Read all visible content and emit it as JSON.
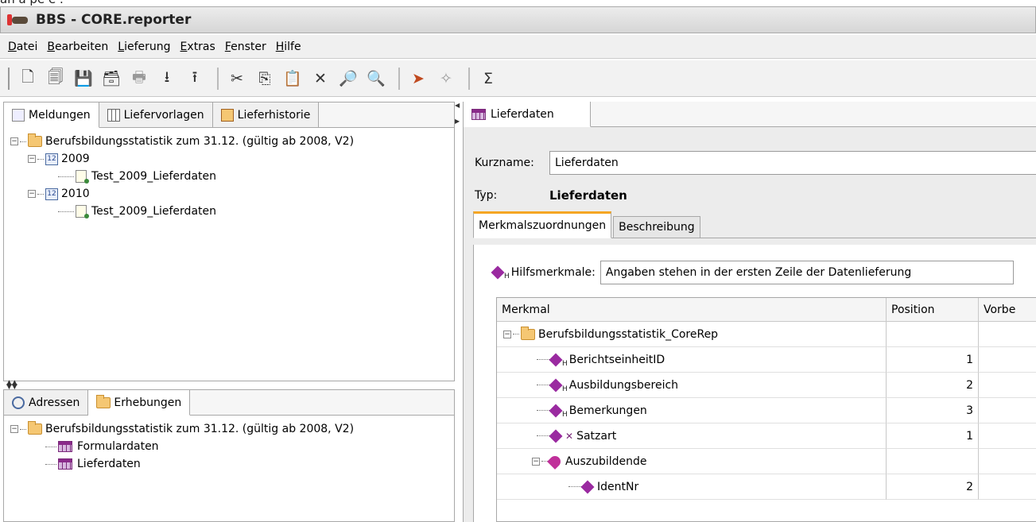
{
  "window": {
    "title": "BBS - CORE.reporter"
  },
  "menu": [
    {
      "label": "Datei",
      "u": "D",
      "rest": "atei"
    },
    {
      "label": "Bearbeiten",
      "u": "B",
      "rest": "earbeiten"
    },
    {
      "label": "Lieferung",
      "u": "L",
      "rest": "ieferung"
    },
    {
      "label": "Extras",
      "u": "E",
      "rest": "xtras"
    },
    {
      "label": "Fenster",
      "u": "F",
      "rest": "enster"
    },
    {
      "label": "Hilfe",
      "u": "H",
      "rest": "ilfe"
    }
  ],
  "toolbar": {
    "sigma": "Σ"
  },
  "left_top": {
    "tabs": [
      "Meldungen",
      "Liefervorlagen",
      "Lieferhistorie"
    ],
    "tree": {
      "root": "Berufsbildungsstatistik zum 31.12. (gültig ab 2008, V2)",
      "y1": "2009",
      "y1_child": "Test_2009_Lieferdaten",
      "y2": "2010",
      "y2_child": "Test_2009_Lieferdaten"
    }
  },
  "left_bottom": {
    "tabs": [
      "Adressen",
      "Erhebungen"
    ],
    "tree": {
      "root": "Berufsbildungsstatistik zum 31.12. (gültig ab 2008, V2)",
      "child1": "Formulardaten",
      "child2": "Lieferdaten"
    }
  },
  "right": {
    "tab": "Lieferdaten",
    "kurzname_label": "Kurzname:",
    "kurzname_value": "Lieferdaten",
    "typ_label": "Typ:",
    "typ_value": "Lieferdaten",
    "subtabs": [
      "Merkmalszuordnungen",
      "Beschreibung"
    ],
    "hilfs_label": "Hilfsmerkmale:",
    "hilfs_value": "Angaben stehen in der ersten Zeile der Datenlieferung",
    "grid": {
      "headers": [
        "Merkmal",
        "Position",
        "Vorbe"
      ],
      "rows": [
        {
          "name": "Berufsbildungsstatistik_CoreRep",
          "pos": ""
        },
        {
          "name": "BerichtseinheitID",
          "pos": "1"
        },
        {
          "name": "Ausbildungsbereich",
          "pos": "2"
        },
        {
          "name": "Bemerkungen",
          "pos": "3"
        },
        {
          "name": "Satzart",
          "pos": "1"
        },
        {
          "name": "Auszubildende",
          "pos": ""
        },
        {
          "name": "IdentNr",
          "pos": "2"
        }
      ]
    }
  }
}
